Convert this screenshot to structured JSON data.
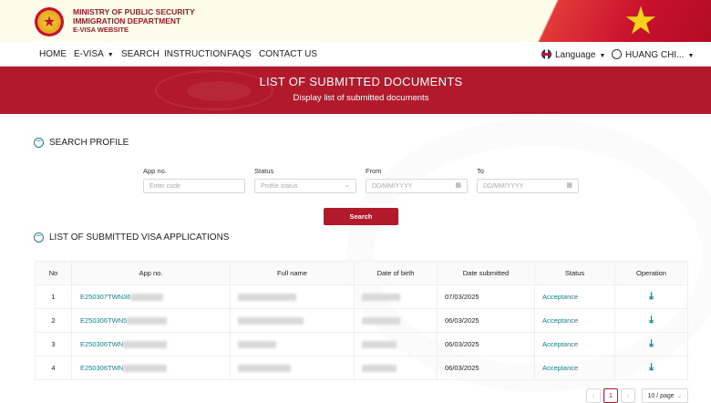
{
  "header": {
    "ministry_line1": "MINISTRY OF PUBLIC SECURITY",
    "ministry_line2": "IMMIGRATION DEPARTMENT",
    "ministry_line3": "E-VISA WEBSITE"
  },
  "nav": {
    "home": "HOME",
    "evisa": "E-VISA",
    "search": "SEARCH",
    "instruction": "INSTRUCTION",
    "faqs": "FAQS",
    "contact": "CONTACT US",
    "language": "Language",
    "user": "HUANG CHI..."
  },
  "banner": {
    "title": "LIST OF SUBMITTED DOCUMENTS",
    "subtitle": "Display list of submitted documents"
  },
  "search_profile": {
    "heading": "SEARCH PROFILE",
    "app_no_label": "App no.",
    "app_no_placeholder": "Enter code",
    "status_label": "Status",
    "status_placeholder": "Profile status",
    "from_label": "From",
    "from_placeholder": "DD/MM/YYYY",
    "to_label": "To",
    "to_placeholder": "DD/MM/YYYY",
    "search_button": "Search"
  },
  "applications": {
    "heading": "LIST OF SUBMITTED VISA APPLICATIONS",
    "columns": [
      "No",
      "App no.",
      "Full name",
      "Date of birth",
      "Date submitted",
      "Status",
      "Operation"
    ],
    "rows": [
      {
        "no": "1",
        "app_no": "E250307TWN36",
        "date_submitted": "07/03/2025",
        "status": "Acceptance"
      },
      {
        "no": "2",
        "app_no": "E250306TWN5",
        "date_submitted": "06/03/2025",
        "status": "Acceptance"
      },
      {
        "no": "3",
        "app_no": "E250306TWN",
        "date_submitted": "06/03/2025",
        "status": "Acceptance"
      },
      {
        "no": "4",
        "app_no": "E250306TWN",
        "date_submitted": "06/03/2025",
        "status": "Acceptance"
      }
    ]
  },
  "pagination": {
    "prev": "‹",
    "current_page": "1",
    "next": "›",
    "page_size": "10 / page"
  },
  "colors": {
    "brand_red": "#b21a2c",
    "accent_teal": "#1a7f8a",
    "star_yellow": "#f7d21a"
  }
}
